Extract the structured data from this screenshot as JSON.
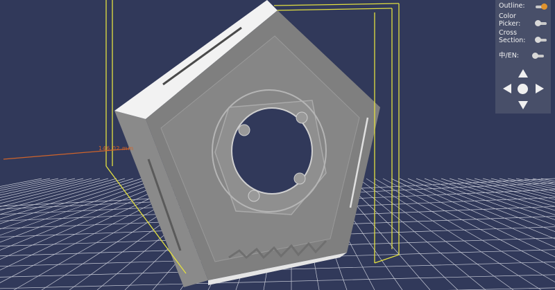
{
  "scene": {
    "dimension_label": "146.02 mm",
    "colors": {
      "background": "#31395a",
      "grid": "#c9ccd8",
      "bounding_box": "#e3e040",
      "model": "#7f7f7f",
      "model_highlight": "#f2f2f2",
      "axis_x": "#d0642a",
      "axis_y": "#3ecb3e",
      "axis_z": "#3a56e0"
    }
  },
  "panel": {
    "outline_label": "Outline:",
    "color_picker_label": "Color Picker:",
    "cross_section_label": "Cross Section:",
    "language_label": "中/EN:",
    "outline_on": true,
    "color_picker_on": false,
    "cross_section_on": false,
    "language_on": false,
    "accent": "#e0932e"
  },
  "nav": {
    "icons": [
      "arrow-up-icon",
      "arrow-left-icon",
      "center-dot-icon",
      "arrow-right-icon",
      "arrow-down-icon"
    ]
  }
}
